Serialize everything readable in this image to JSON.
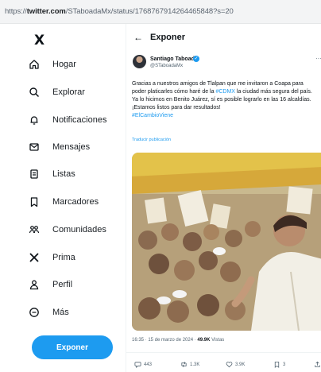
{
  "browser": {
    "url_prefix": "https://",
    "url_domain": "twitter.com",
    "url_path": "/STaboadaMx/status/1768767914264465848?s=20"
  },
  "sidebar": {
    "logo": "X",
    "items": [
      {
        "label": "Hogar",
        "icon": "home-icon"
      },
      {
        "label": "Explorar",
        "icon": "search-icon"
      },
      {
        "label": "Notificaciones",
        "icon": "bell-icon"
      },
      {
        "label": "Mensajes",
        "icon": "mail-icon"
      },
      {
        "label": "Listas",
        "icon": "list-icon"
      },
      {
        "label": "Marcadores",
        "icon": "bookmark-icon"
      },
      {
        "label": "Comunidades",
        "icon": "communities-icon"
      },
      {
        "label": "Prima",
        "icon": "x-logo-icon"
      },
      {
        "label": "Perfil",
        "icon": "person-icon"
      },
      {
        "label": "Más",
        "icon": "more-circle-icon"
      }
    ],
    "post_button": "Exponer"
  },
  "main": {
    "back": "←",
    "title": "Exponer"
  },
  "tweet": {
    "author_name": "Santiago Taboada",
    "author_handle": "@STaboadaMx",
    "more": "···",
    "text": {
      "l1": "Gracias a nuestros amigos de Tlalpan que me invitaron a Coapa para",
      "l2a": "poder platicarles cómo haré de la ",
      "l2_tag": "#CDMX",
      "l2b": " la ciudad más segura del país.",
      "l3": "Ya lo hicimos en Benito Juárez, sí es posible lograrlo en las 16 alcaldías.",
      "l4": "¡Estamos listos para dar resultados!",
      "hashtag": "#ElCambioViene"
    },
    "translate": "Traducir publicación",
    "time": "16:35 · 15 de marzo de 2024 · ",
    "views": "49.9K",
    "views_label": " Vistas",
    "actions": {
      "replies": "443",
      "retweets": "1.3K",
      "likes": "3.9K",
      "bookmarks": "3"
    }
  },
  "colors": {
    "accent": "#1d9bf0",
    "text": "#0f1419",
    "muted": "#536471"
  }
}
